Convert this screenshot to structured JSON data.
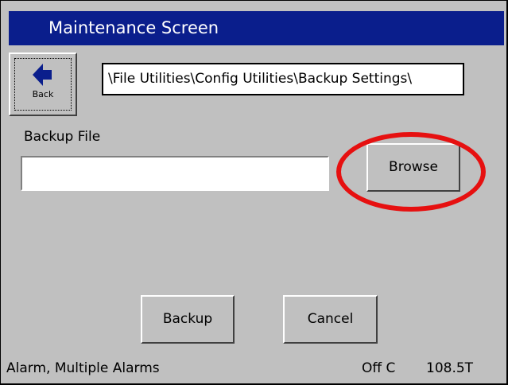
{
  "window": {
    "title": "Maintenance Screen"
  },
  "toolbar": {
    "back_label": "Back",
    "back_icon": "arrow-left-icon"
  },
  "path": {
    "value": "\\File Utilities\\Config Utilities\\Backup Settings\\"
  },
  "backup_file": {
    "label": "Backup File",
    "value": ""
  },
  "buttons": {
    "browse": "Browse",
    "backup": "Backup",
    "cancel": "Cancel"
  },
  "status_bar": {
    "alarm": "Alarm, Multiple Alarms",
    "mode": "Off C",
    "value": "108.5T"
  },
  "colors": {
    "title_bar": "#0a1e8c",
    "background": "#c0c0c0",
    "highlight": "#e61010"
  }
}
